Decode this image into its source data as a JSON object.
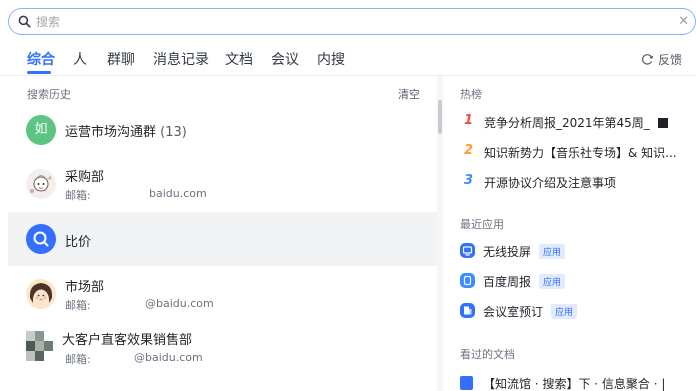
{
  "search": {
    "placeholder": "搜索",
    "clear_icon": "✕"
  },
  "tabs": [
    {
      "label": "综合"
    },
    {
      "label": "人"
    },
    {
      "label": "群聊"
    },
    {
      "label": "消息记录"
    },
    {
      "label": "文档"
    },
    {
      "label": "会议"
    },
    {
      "label": "内搜"
    }
  ],
  "feedback_label": "反馈",
  "history": {
    "title": "搜索历史",
    "clear_label": "清空",
    "items": [
      {
        "title": "运营市场沟通群",
        "count": "(13)",
        "avatar_text": "如"
      },
      {
        "title": "采购部",
        "sub_label": "邮箱:",
        "email": "baidu.com"
      },
      {
        "title": "比价"
      },
      {
        "title": "市场部",
        "sub_label": "邮箱:",
        "email": "@baidu.com"
      },
      {
        "title": "大客户直客效果销售部",
        "sub_label": "邮箱:",
        "email": "@baidu.com"
      }
    ]
  },
  "hot": {
    "title": "热榜",
    "items": [
      {
        "rank": "1",
        "text": "竞争分析周报_2021年第45周_"
      },
      {
        "rank": "2",
        "text": "知识新势力【音乐社专场】& 知识..."
      },
      {
        "rank": "3",
        "text": "开源协议介绍及注意事项"
      }
    ]
  },
  "recent_apps": {
    "title": "最近应用",
    "badge": "应用",
    "items": [
      {
        "label": "无线投屏"
      },
      {
        "label": "百度周报"
      },
      {
        "label": "会议室预订"
      }
    ]
  },
  "viewed_docs": {
    "title": "看过的文档",
    "items": [
      {
        "label": "【知流馆 · 搜索】下 · 信息聚合 · |"
      }
    ]
  },
  "colors": {
    "accent": "#3370ff",
    "rank1": "#f54a45",
    "rank2": "#ff9b2e",
    "rank3": "#3c8cff",
    "group_avatar": "#5dc584",
    "search_avatar": "#3370ff"
  }
}
